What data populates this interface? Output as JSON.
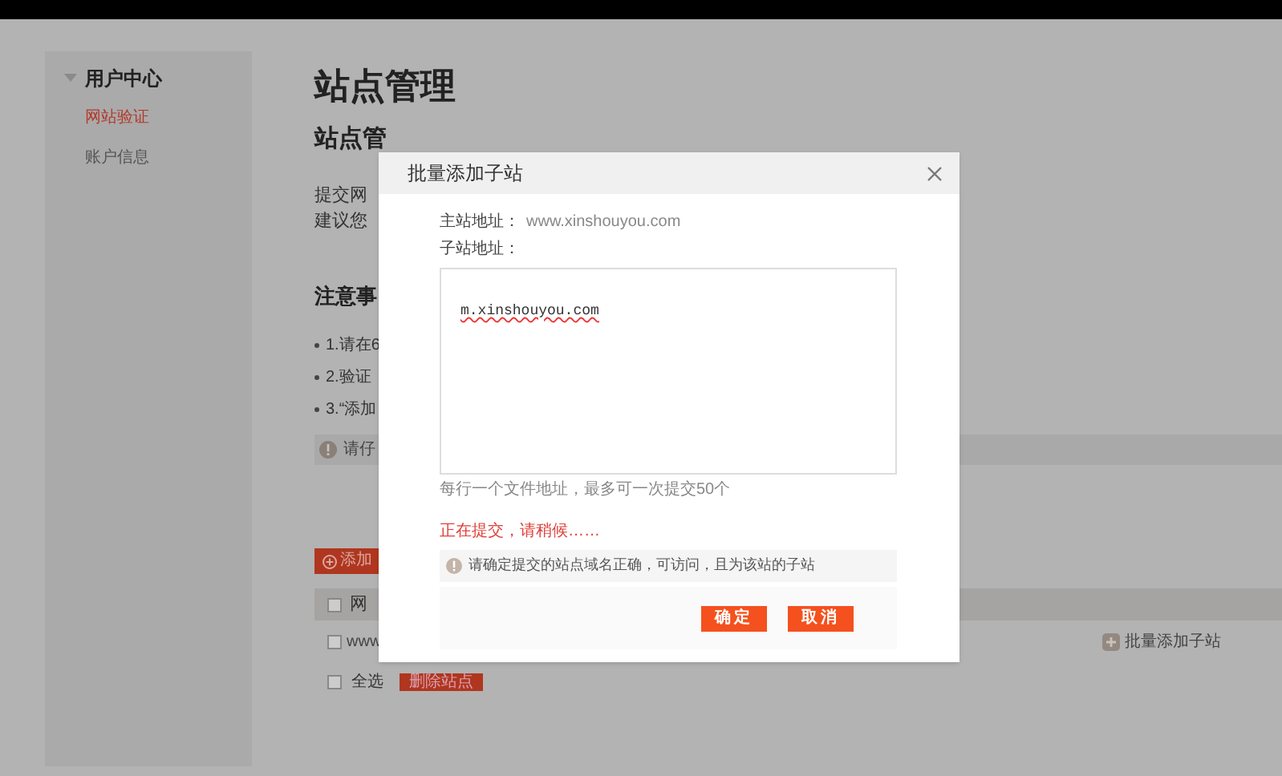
{
  "sidebar": {
    "title": "用户中心",
    "expanded": true,
    "items": [
      {
        "label": "网站验证",
        "selected": true
      },
      {
        "label": "账户信息",
        "selected": false
      }
    ]
  },
  "page": {
    "title": "站点管理",
    "section_1_heading": "站点管",
    "paragraph_lines": [
      "提交网",
      "建议您"
    ],
    "section_2_heading": "注意事",
    "notes": [
      "1.请在6",
      "2.验证",
      "3.“添加"
    ],
    "notice": "请仔",
    "add_button": "添加",
    "table": {
      "header_checked": false,
      "columns": [
        "网"
      ],
      "rows": [
        {
          "site": "www",
          "checked": false
        }
      ]
    },
    "batch_add_link": "批量添加子站",
    "select_all": {
      "label": "全选",
      "checked": false
    },
    "delete_button": "删除站点"
  },
  "dialog": {
    "title": "批量添加子站",
    "main_site_label": "主站地址：",
    "main_site": "www.xinshouyou.com",
    "sub_site_label": "子站地址：",
    "sub_sites": "m.xinshouyou.com",
    "hint": "每行一个文件地址，最多可一次提交50个",
    "status": "正在提交，请稍候……",
    "notice": "请确定提交的站点域名正确，可访问，且为该站的子站",
    "buttons": [
      "确定",
      "取消"
    ]
  }
}
